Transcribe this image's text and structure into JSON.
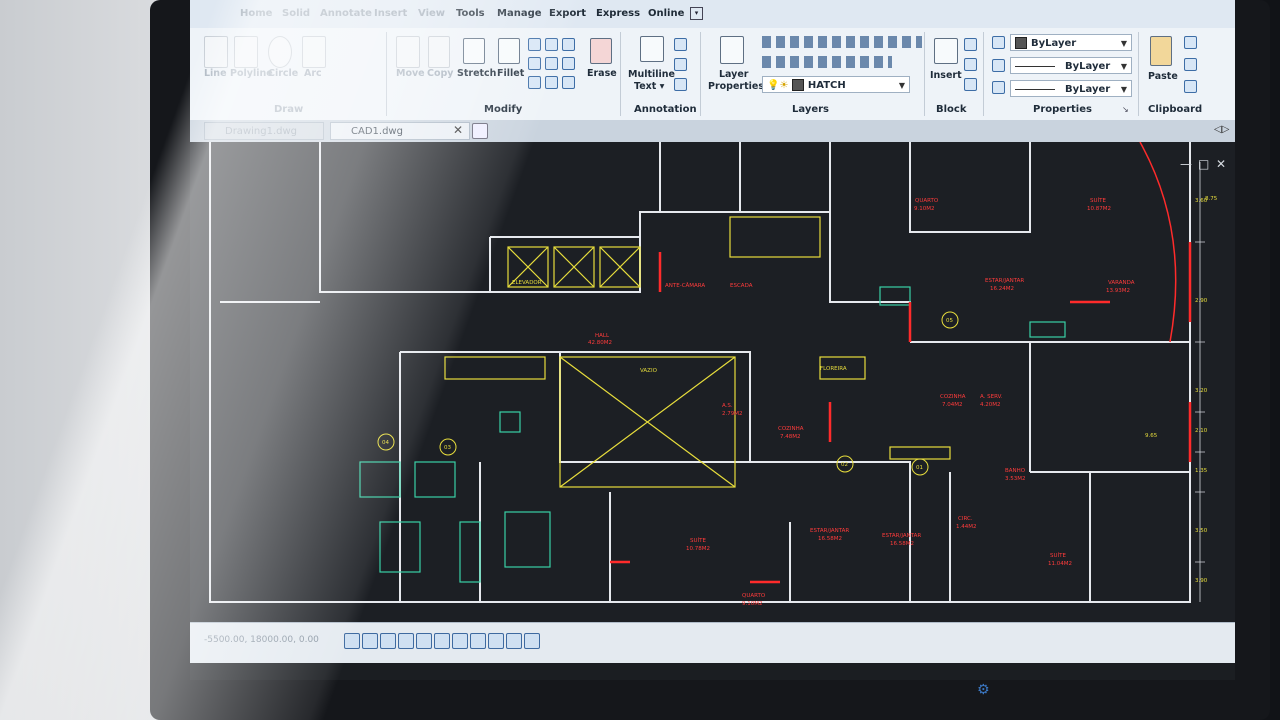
{
  "ribbon_tabs": [
    {
      "label": "Home",
      "dim": true
    },
    {
      "label": "Solid",
      "dim": true
    },
    {
      "label": "Annotate",
      "dim": true
    },
    {
      "label": "Insert",
      "dim": true
    },
    {
      "label": "View",
      "dim": true
    },
    {
      "label": "Tools",
      "dim": false
    },
    {
      "label": "Manage",
      "dim": false
    },
    {
      "label": "Export",
      "dim": false
    },
    {
      "label": "Express",
      "dim": false
    },
    {
      "label": "Online",
      "dim": false
    }
  ],
  "ribbon": {
    "draw": {
      "title": "Draw",
      "buttons": [
        "Line",
        "Polyline",
        "Circle",
        "Arc"
      ]
    },
    "modify": {
      "title": "Modify",
      "buttons": [
        "Move",
        "Copy",
        "Stretch",
        "Fillet",
        "Erase"
      ]
    },
    "annotation": {
      "title": "Annotation",
      "multiline_1": "Multiline",
      "multiline_2": "Text ▾"
    },
    "layers": {
      "title": "Layers",
      "layer_properties_1": "Layer",
      "layer_properties_2": "Properties",
      "current_layer": "HATCH"
    },
    "block": {
      "title": "Block",
      "insert": "Insert"
    },
    "properties": {
      "title": "Properties",
      "color": "ByLayer",
      "linetype": "ByLayer",
      "lineweight": "ByLayer"
    },
    "clipboard": {
      "title": "Clipboard",
      "paste": "Paste"
    }
  },
  "document_tabs": [
    {
      "label": "Drawing1.dwg"
    },
    {
      "label": "CAD1.dwg"
    }
  ],
  "status": {
    "coords": "-5500.00, 18000.00, 0.00"
  },
  "window_controls": {
    "minimize": "—",
    "restore": "□",
    "close": "✕"
  },
  "plan_labels": {
    "hall": "HALL",
    "hall_area": "42.80M2",
    "vazio": "VAZIO",
    "elevador": "ELEVADOR",
    "ante_camara": "ANTE-CÂMARA",
    "escada": "ESCADA",
    "quarto": "QUARTO",
    "quarto_area": "9.10M2",
    "suite": "SUÍTE",
    "suite_area": "10.87M2",
    "estar_jantar": "ESTAR/JANTAR",
    "estar_area": "16.24M2",
    "varanda": "VARANDA",
    "varanda_area": "13.93M2",
    "cozinha": "COZINHA",
    "cozinha_area": "7.04M2",
    "a_serv": "A. SERV.",
    "a_serv_area": "4.20M2",
    "circ": "CIRC.",
    "circ_area": "1.44M2",
    "banho": "BANHO",
    "banho_area": "3.53M2",
    "suite2": "SUÍTE",
    "suite2_area": "10.78M2",
    "quarto2": "QUARTO",
    "quarto2_area": "9.10M2",
    "estar2": "ESTAR/JANTAR",
    "estar2_area": "16.58M2",
    "estar3": "ESTAR/JANTAR",
    "estar3_area": "16.58M2",
    "suite3": "SUÍTE",
    "suite3_area": "11.04M2",
    "a_s": "A.S.",
    "a_s_area": "2.79M2",
    "cozinha2": "COZINHA",
    "cozinha2_area": "7.48M2",
    "floreira": "FLOREIRA",
    "dim1": "3.60",
    "dim2": "2.90",
    "dim3": "3.20",
    "dim4": "2.10",
    "dim5": "1.35",
    "dim6": "3.50",
    "dim7": "3.90",
    "dim8": "8.75",
    "dim9": "9.65",
    "axis1": "01",
    "axis2": "02",
    "axis3": "03",
    "axis4": "04",
    "axis5": "05"
  },
  "colors": {
    "ribbon_bg": "#eef3f8",
    "drawing_bg": "#1c1f24",
    "wall": "#e6e9ee",
    "green": "#39d0a6",
    "yellow": "#e7dd3c",
    "red": "#ff2b2b"
  }
}
